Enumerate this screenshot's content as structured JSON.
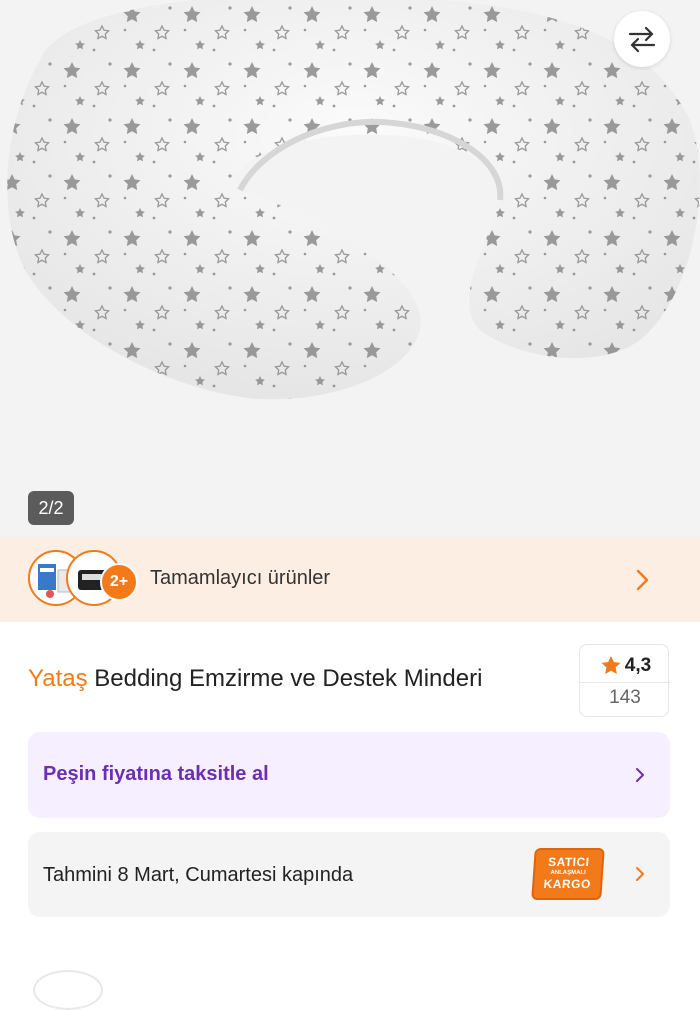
{
  "gallery": {
    "image_alt": "U şeklinde yıldız desenli emzirme yastığı",
    "counter": "2/2",
    "swap_icon": "swap-arrows-icon"
  },
  "complementary": {
    "badge": "2+",
    "label": "Tamamlayıcı ürünler",
    "chevron_icon": "chevron-right-icon"
  },
  "product": {
    "brand": "Yataş",
    "name": "Bedding Emzirme ve Destek Minderi",
    "rating": "4,3",
    "review_count": "143"
  },
  "installment": {
    "label": "Peşin fiyatına taksitle al"
  },
  "delivery": {
    "label": "Tahmini 8 Mart, Cumartesi kapında",
    "badge_line1": "SATICI",
    "badge_line2": "ANLAŞMALI",
    "badge_line3": "KARGO"
  },
  "colors": {
    "accent": "#f27a1a",
    "purple": "#6b2fb4",
    "complement_bg": "#fdeee3",
    "installment_bg": "#f6efff"
  }
}
